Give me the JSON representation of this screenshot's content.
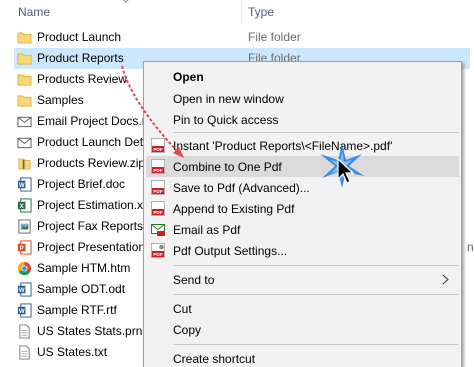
{
  "header": {
    "name_label": "Name",
    "type_label": "Type"
  },
  "files": [
    {
      "name": "Product Launch",
      "type": "File folder",
      "icon": "folder-icon"
    },
    {
      "name": "Product Reports",
      "type": "File folder",
      "icon": "folder-icon",
      "selected": true
    },
    {
      "name": "Products Review",
      "type": "",
      "icon": "folder-icon"
    },
    {
      "name": "Samples",
      "type": "",
      "icon": "folder-icon"
    },
    {
      "name": "Email Project Docs.r",
      "type": "",
      "icon": "email-icon"
    },
    {
      "name": "Product Launch Det",
      "type": "",
      "icon": "email-icon"
    },
    {
      "name": "Products Review.zip",
      "type": "",
      "icon": "zip-icon"
    },
    {
      "name": "Project Brief.doc",
      "type": "",
      "icon": "word-doc-icon"
    },
    {
      "name": "Project Estimation.x",
      "type": "",
      "icon": "excel-icon"
    },
    {
      "name": "Project Fax Reports.",
      "type": "",
      "icon": "tiff-icon"
    },
    {
      "name": "Project Presentation",
      "type": "",
      "icon": "powerpoint-icon",
      "clipped_type": "n"
    },
    {
      "name": "Sample HTM.htm",
      "type": "",
      "icon": "chrome-icon"
    },
    {
      "name": "Sample ODT.odt",
      "type": "",
      "icon": "word-doc-icon"
    },
    {
      "name": "Sample RTF.rtf",
      "type": "",
      "icon": "word-doc-icon"
    },
    {
      "name": "US States Stats.prn",
      "type": "",
      "icon": "text-file-icon"
    },
    {
      "name": "US States.txt",
      "type": "",
      "icon": "text-file-icon"
    }
  ],
  "context_menu": {
    "open": "Open",
    "open_new_window": "Open in new window",
    "pin_quick_access": "Pin to Quick access",
    "instant_pdf": "Instant 'Product Reports\\<FileName>.pdf'",
    "combine_pdf": "Combine to One Pdf",
    "save_pdf_advanced": "Save to Pdf (Advanced)...",
    "append_pdf": "Append to Existing Pdf",
    "email_pdf": "Email as Pdf",
    "pdf_output_settings": "Pdf Output Settings...",
    "send_to": "Send to",
    "cut": "Cut",
    "copy": "Copy",
    "create_shortcut": "Create shortcut"
  },
  "colors": {
    "selection": "#cce8ff",
    "menu_bg": "#f2f2f2",
    "menu_hover": "#dadada",
    "folder": "#f8d775",
    "arrow": "#e0484b",
    "spark": "#1e7fe0"
  }
}
